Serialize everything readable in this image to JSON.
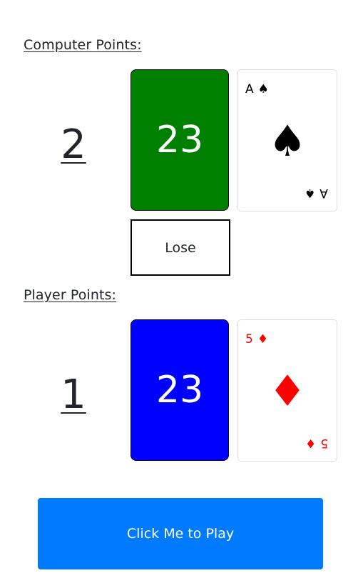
{
  "computer": {
    "label": "Computer Points:",
    "points": "2",
    "counter_value": "23",
    "counter_color": "#008000",
    "card": {
      "rank": "A",
      "suit": "♠",
      "suit_name": "spade-icon",
      "color": "#000000"
    },
    "result": "Lose"
  },
  "player": {
    "label": "Player Points:",
    "points": "1",
    "counter_value": "23",
    "counter_color": "#0000ff",
    "card": {
      "rank": "5",
      "suit": "♦",
      "suit_name": "diamond-icon",
      "color": "#ff0000"
    }
  },
  "play_button": {
    "label": "Click Me to Play",
    "color": "#007bff"
  }
}
